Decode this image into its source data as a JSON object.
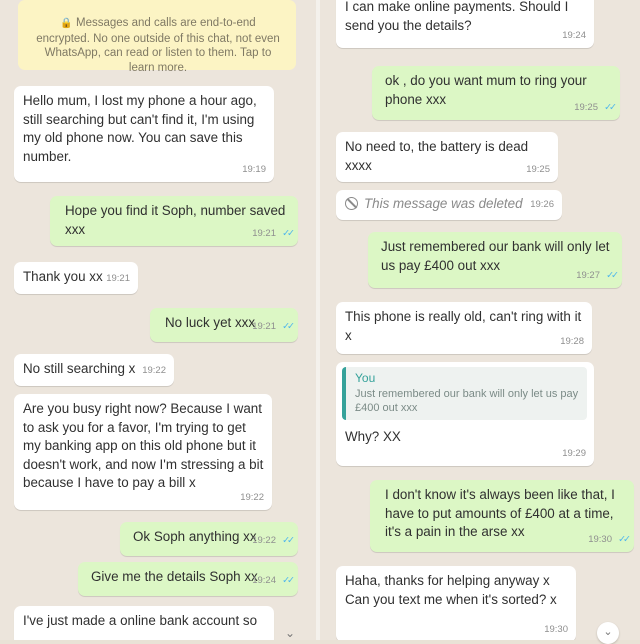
{
  "left_chat": {
    "encryption_notice": "Messages and calls are end-to-end encrypted. No one outside of this chat, not even WhatsApp, can read or listen to them. Tap to learn more.",
    "messages": [
      {
        "dir": "in",
        "text": "Hello mum, I lost my phone a hour ago, still searching but can't find it, I'm using my old phone now. You can save this number.",
        "time": "19:19"
      },
      {
        "dir": "out",
        "text": "Hope you find it Soph, number saved xxx",
        "time": "19:21"
      },
      {
        "dir": "in",
        "text": "Thank you xx",
        "time": "19:21"
      },
      {
        "dir": "out",
        "text": "No luck yet xxx",
        "time": "19:21"
      },
      {
        "dir": "in",
        "text": "No still searching x",
        "time": "19:22"
      },
      {
        "dir": "in",
        "text": "Are you busy right now? Because I want to ask you for a favor, I'm trying to get my banking app on this old phone but it doesn't work, and now I'm stressing a bit because I have to pay a bill x",
        "time": "19:22"
      },
      {
        "dir": "out",
        "text": "Ok Soph anything xx",
        "time": "19:22"
      },
      {
        "dir": "out",
        "text": "Give me the details Soph xx",
        "time": "19:24"
      },
      {
        "dir": "in",
        "text": "I've just made a online bank account so ",
        "time": ""
      }
    ]
  },
  "right_chat": {
    "messages": [
      {
        "dir": "in",
        "text": "I can make online payments. Should I send you the details?",
        "time": "19:24"
      },
      {
        "dir": "out",
        "text": "ok , do you want mum to ring your phone xxx",
        "time": "19:25"
      },
      {
        "dir": "in",
        "text": "No need to, the battery is dead xxxx",
        "time": "19:25"
      },
      {
        "dir": "in",
        "deleted": true,
        "text": "This message was deleted",
        "time": "19:26"
      },
      {
        "dir": "out",
        "text": "Just remembered our bank will only let us pay £400 out xxx",
        "time": "19:27"
      },
      {
        "dir": "in",
        "text": "This phone is really old, can't ring with it x",
        "time": "19:28"
      },
      {
        "dir": "in",
        "quote_name": "You",
        "quote_text": "Just remembered our bank will only let us pay £400 out xxx",
        "text": "Why? XX",
        "time": "19:29"
      },
      {
        "dir": "out",
        "text": "I don't know it's always been like that, I have to put amounts of £400 at a time, it's a pain in the arse xx",
        "time": "19:30"
      },
      {
        "dir": "in",
        "text": "Haha, thanks for helping anyway x Can you text me when it's sorted? x",
        "time": "19:30"
      }
    ]
  },
  "icons": {
    "read_ticks": "double-check-icon",
    "lock": "lock-icon",
    "deleted": "ban-icon",
    "scroll_down": "chevron-down-icon"
  },
  "colors": {
    "incoming": "#ffffff",
    "outgoing": "#dcf7c5",
    "notice": "#fcf4c4",
    "tick_blue": "#4fb6ec",
    "quote_accent": "#35a29a"
  }
}
